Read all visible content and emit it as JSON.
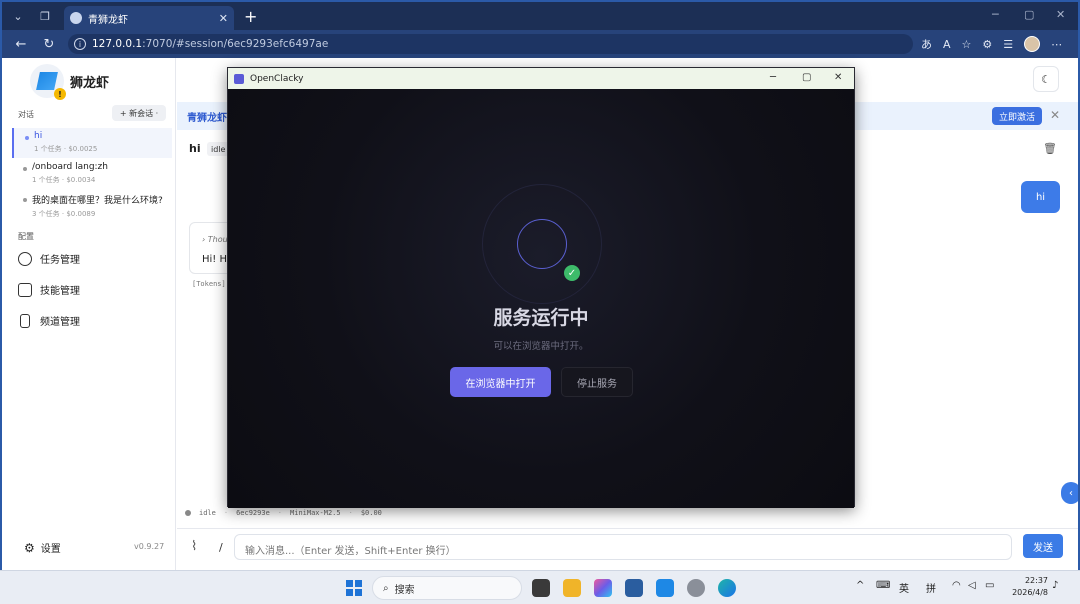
{
  "browser": {
    "tab_title": "青狮龙虾",
    "url_host": "127.0.0.1",
    "url_path": ":7070/#session/6ec9293efc6497ae"
  },
  "app": {
    "name": "狮龙虾",
    "sections": {
      "conversations": "对话",
      "config": "配置"
    },
    "new_session": "+ 新会话 ·",
    "sessions": [
      {
        "title": "hi",
        "meta": "1 个任务 · $0.0025"
      },
      {
        "title": "/onboard lang:zh",
        "meta": "1 个任务 · $0.0034"
      },
      {
        "title": "我的桌面在哪里？我是什么环境?",
        "meta": "3 个任务 · $0.0089"
      }
    ],
    "config_items": [
      "任务管理",
      "技能管理",
      "频道管理"
    ],
    "settings": "设置",
    "version": "v0.9.27"
  },
  "main": {
    "banner_text": "青狮龙虾",
    "activate": "立即激活",
    "title": "hi",
    "status_badge": "idle",
    "user_message": "hi",
    "thought_label": "› Thou",
    "assistant_text": "Hi! Ho",
    "tokens_label": "[Tokens]",
    "statusbar": {
      "state": "idle",
      "session": "6ec9293e",
      "model": "MiniMax-M2.5",
      "cost": "$0.00"
    },
    "input_placeholder": "输入消息...（Enter 发送，Shift+Enter 换行）",
    "send": "发送",
    "slash": "/"
  },
  "dialog": {
    "title": "OpenClacky",
    "heading": "服务运行中",
    "subtext": "可以在浏览器中打开。",
    "open_button": "在浏览器中打开",
    "stop_button": "停止服务"
  },
  "taskbar": {
    "search": "搜索",
    "ime_lang": "英",
    "ime_mode": "拼",
    "time": "22:37",
    "date": "2026/4/8"
  },
  "colors": {
    "accent": "#3b7be6",
    "dialog_button": "#6a67e8",
    "success": "#3dbb6a"
  }
}
